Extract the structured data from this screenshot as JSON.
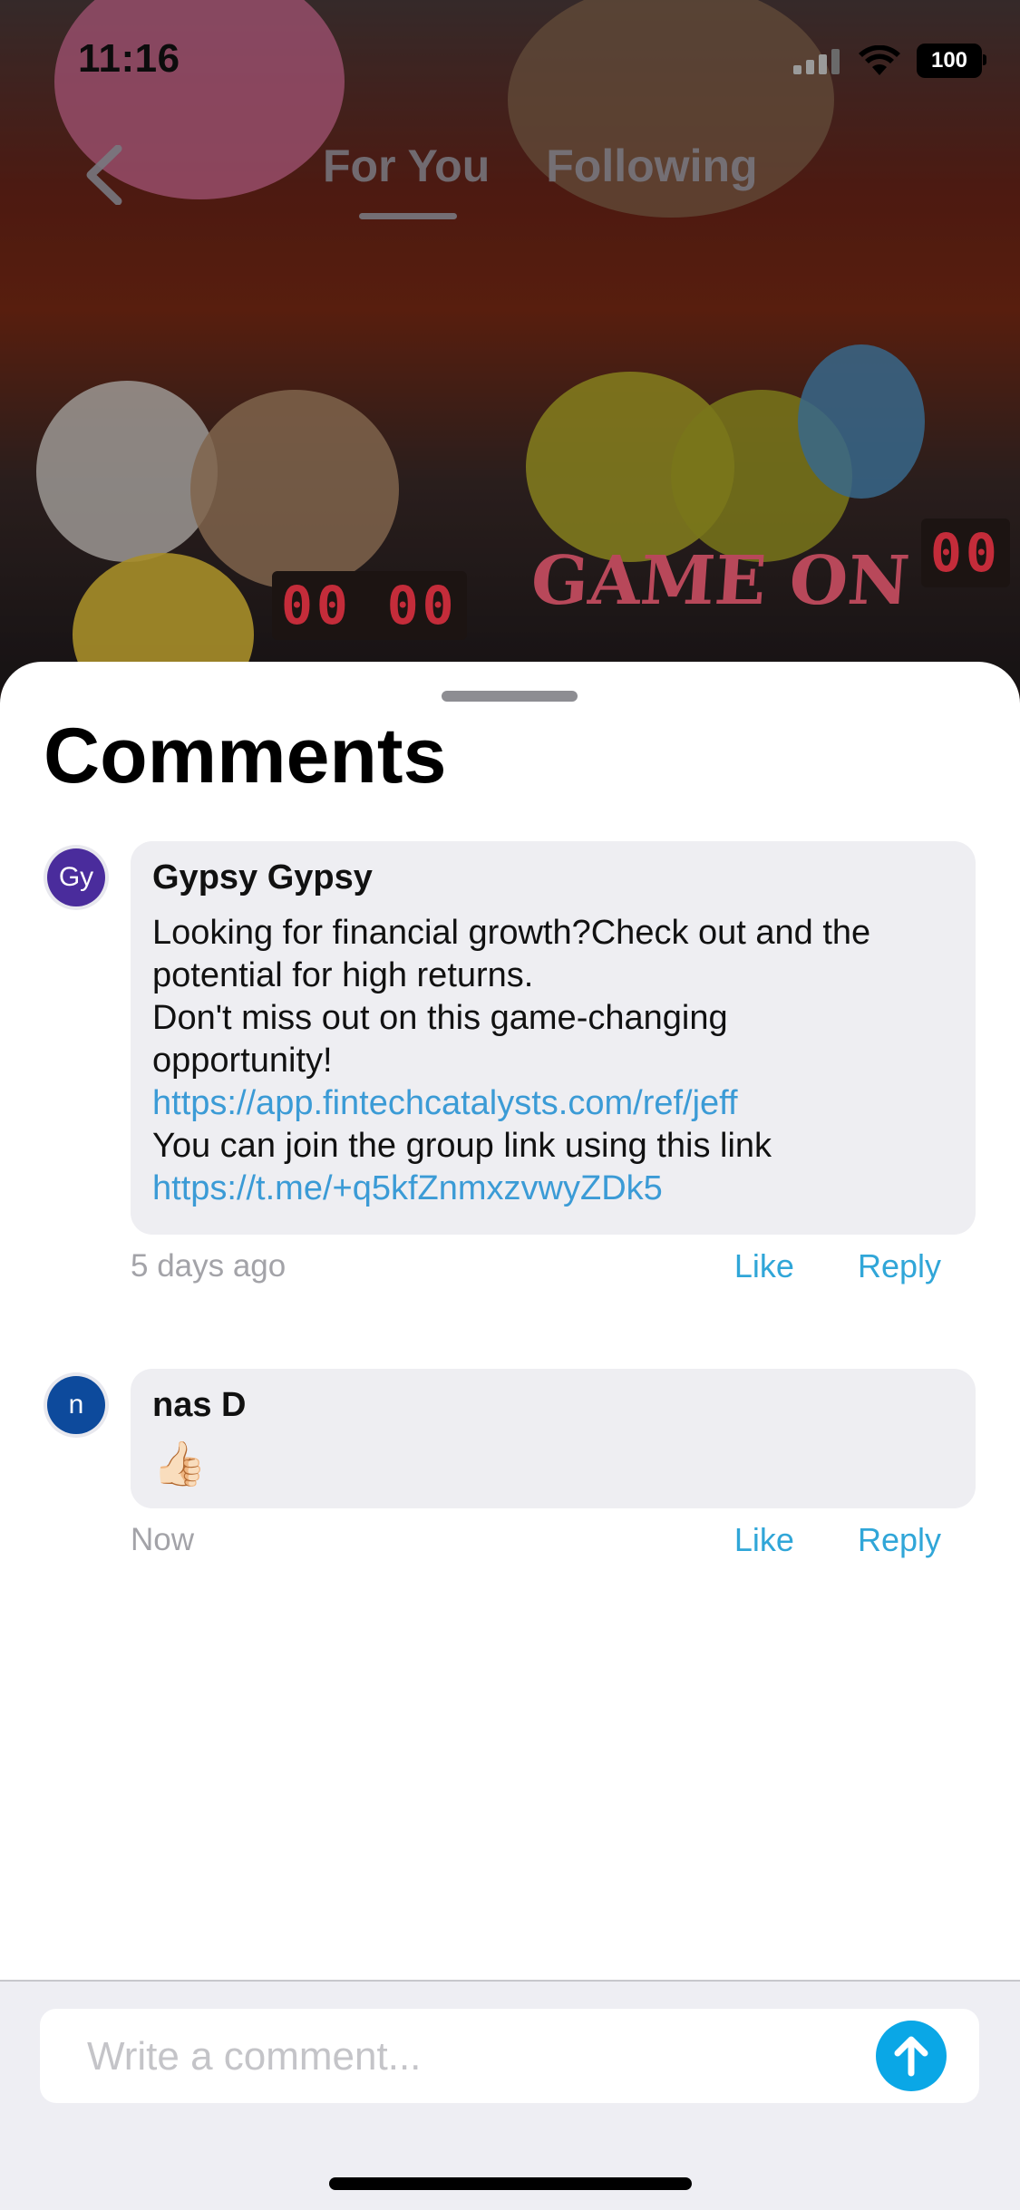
{
  "status_bar": {
    "time": "11:16",
    "battery": "100"
  },
  "nav": {
    "tabs": [
      {
        "label": "For You",
        "active": true
      },
      {
        "label": "Following",
        "active": false
      }
    ]
  },
  "video": {
    "counter_left": "00 00",
    "counter_right": "00",
    "sign_text": "GAME ON"
  },
  "comments_sheet": {
    "title": "Comments",
    "comments": [
      {
        "avatar_initials": "Gy",
        "avatar_color": "#4a2c9c",
        "author": "Gypsy Gypsy",
        "lines": [
          "Looking for financial growth?Check out and the",
          "potential for high returns.",
          "Don't miss out on this game-changing",
          "opportunity!",
          "https://app.fintechcatalysts.com/ref/jeff",
          "You can join the group link using this link",
          "https://t.me/+q5kfZnmxzvwyZDk5"
        ],
        "time": "5 days ago",
        "like_label": "Like",
        "reply_label": "Reply"
      },
      {
        "avatar_initials": "n",
        "avatar_color": "#0d4a9c",
        "author": "nas D",
        "emoji": "👍🏻",
        "time": "Now",
        "like_label": "Like",
        "reply_label": "Reply"
      }
    ]
  },
  "composer": {
    "placeholder": "Write a comment...",
    "send_icon": "arrow-up-icon",
    "accent": "#0aa7e6"
  },
  "colors": {
    "link": "#3b9bd6",
    "action": "#30a6d8",
    "bubble": "#eeeef2"
  }
}
